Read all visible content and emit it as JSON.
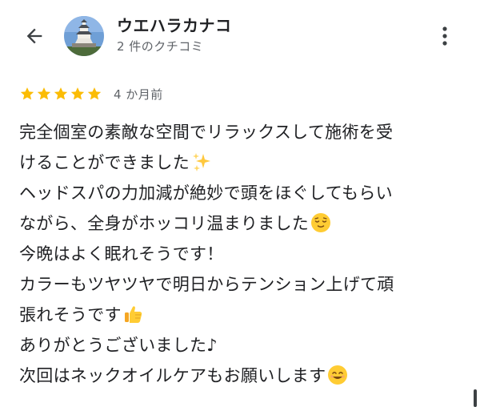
{
  "header": {
    "reviewer_name": "ウエハラカナコ",
    "review_count": "2 件のクチコミ"
  },
  "rating": {
    "stars": 5,
    "max_stars": 5,
    "date": "4 か月前"
  },
  "review": {
    "lines": [
      "完全個室の素敵な空間でリラックスして施術を受",
      "けることができました",
      "ヘッドスパの力加減が絶妙で頭をほぐしてもらい",
      "ながら、全身がホッコリ温まりました",
      "今晩はよく眠れそうです！",
      "カラーもツヤツヤで明日からテンション上げて頑",
      "張れそうです",
      "ありがとうございました♪",
      "次回はネックオイルケアもお願いします"
    ]
  },
  "icons": {
    "back": "arrow-left-icon",
    "more": "more-vert-icon",
    "star": "star-icon",
    "sparkles": "sparkles-emoji",
    "relieved": "relieved-face-emoji",
    "thumbs_up": "thumbs-up-emoji",
    "smile": "smiling-face-emoji"
  },
  "colors": {
    "star": "#FBBC04",
    "text_primary": "#202124",
    "text_secondary": "#5f6368",
    "emoji_yellow": "#FFCC33"
  }
}
